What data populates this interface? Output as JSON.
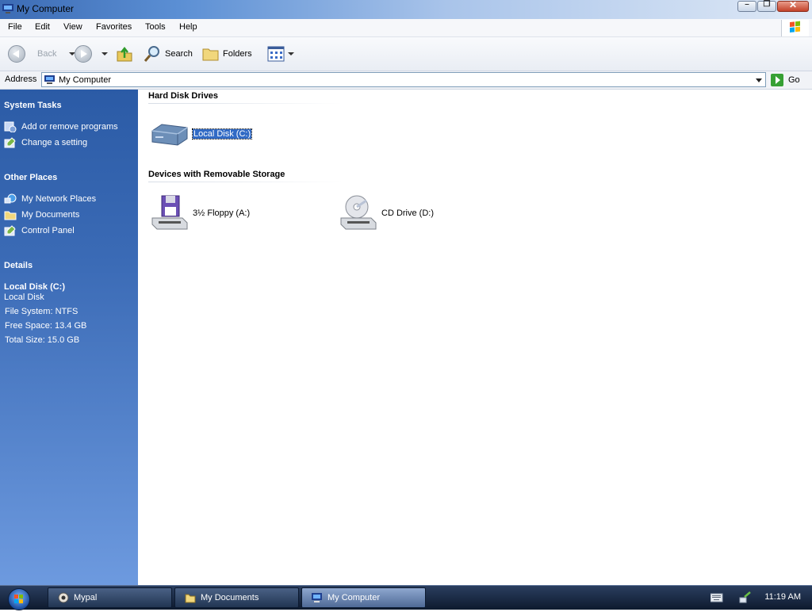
{
  "window": {
    "title": "My Computer",
    "controls": {
      "minimize": "–",
      "restore": "❐",
      "close": "✕"
    }
  },
  "menu": {
    "items": [
      "File",
      "Edit",
      "View",
      "Favorites",
      "Tools",
      "Help"
    ]
  },
  "toolbar": {
    "back_label": "Back",
    "search_label": "Search",
    "folders_label": "Folders"
  },
  "address": {
    "label": "Address",
    "value": "My Computer",
    "go_label": "Go"
  },
  "sidebar": {
    "system_tasks": {
      "heading": "System Tasks",
      "items": [
        "Add or remove programs",
        "Change a setting"
      ]
    },
    "other_places": {
      "heading": "Other Places",
      "items": [
        "My Network Places",
        "My Documents",
        "Control Panel"
      ]
    },
    "details": {
      "heading": "Details",
      "name": "Local Disk (C:)",
      "type": "Local Disk",
      "file_system": "File System: NTFS",
      "free_space": "Free Space: 13.4 GB",
      "total_size": "Total Size: 15.0 GB"
    }
  },
  "content": {
    "groups": [
      {
        "heading": "Hard Disk Drives",
        "items": [
          "Local Disk (C:)"
        ]
      },
      {
        "heading": "Devices with Removable Storage",
        "items": [
          "3½ Floppy (A:)",
          "CD Drive (D:)"
        ]
      }
    ],
    "selected_item": "Local Disk (C:)"
  },
  "taskbar": {
    "tasks": [
      "Mypal",
      "My Documents",
      "My Computer"
    ],
    "active_task": "My Computer",
    "clock": "11:19 AM"
  },
  "colors": {
    "sidebar": "#3b6bb6",
    "selection": "#316ac5",
    "taskbar": "#1a2a45"
  }
}
